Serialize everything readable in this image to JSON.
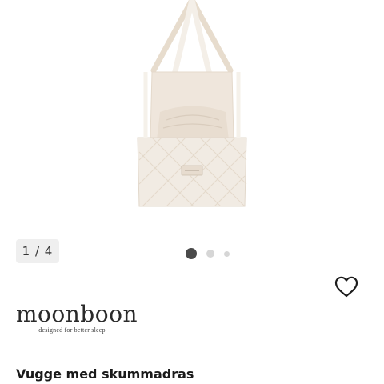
{
  "gallery": {
    "counter_text": "1 / 4",
    "dots": [
      "active",
      "inactive",
      "inactive"
    ]
  },
  "brand": {
    "name": "moonboon",
    "tagline": "designed for better sleep"
  },
  "product": {
    "title": "Vugge med skummadras"
  },
  "icons": {
    "wishlist": "heart-outline-icon"
  },
  "colors": {
    "fabric": "#efe7dd",
    "strap": "#e6dccd",
    "counter_bg": "#efefef",
    "dot_active": "#4a4a4a",
    "dot_inactive": "#d6d6d6"
  }
}
